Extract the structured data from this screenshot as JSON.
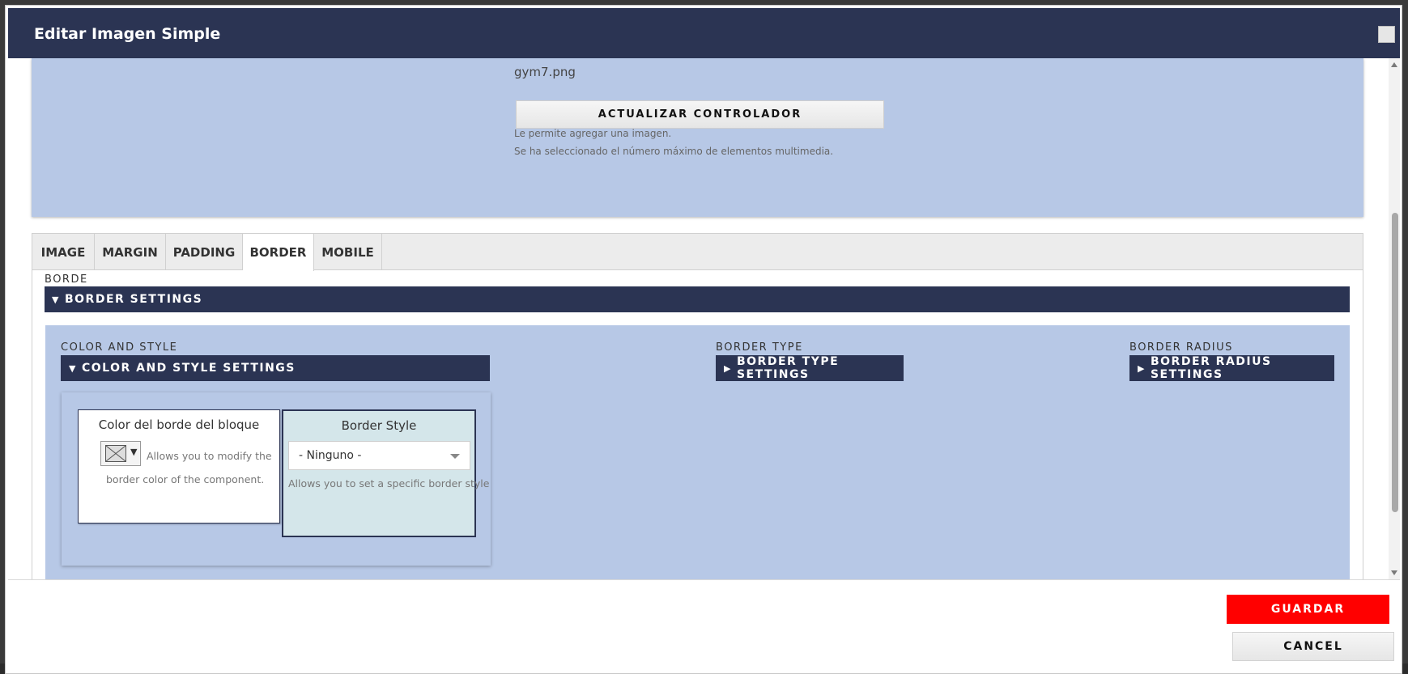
{
  "dialog": {
    "title": "Editar Imagen Simple"
  },
  "upload": {
    "filename": "gym7.png",
    "update_button": "ACTUALIZAR CONTROLADOR",
    "help_1": "Le permite agregar una imagen.",
    "help_2": "Se ha seleccionado el número máximo de elementos multimedia."
  },
  "tabs": [
    {
      "label": "IMAGE",
      "active": false
    },
    {
      "label": "MARGIN",
      "active": false
    },
    {
      "label": "PADDING",
      "active": false
    },
    {
      "label": "BORDER",
      "active": true
    },
    {
      "label": "MOBILE",
      "active": false
    }
  ],
  "border": {
    "section_label": "BORDE",
    "settings_bar": "BORDER SETTINGS",
    "color_style": {
      "label": "COLOR AND STYLE",
      "bar": "COLOR AND STYLE SETTINGS",
      "color_card": {
        "title": "Color del borde del bloque",
        "help": "Allows you to modify the border color of the component."
      },
      "style_card": {
        "title": "Border Style",
        "selected": "- Ninguno -",
        "help": "Allows you to set a specific border style"
      }
    },
    "border_type": {
      "label": "BORDER TYPE",
      "bar": "BORDER TYPE SETTINGS"
    },
    "border_radius": {
      "label": "BORDER RADIUS",
      "bar": "BORDER RADIUS SETTINGS"
    }
  },
  "footer": {
    "save": "GUARDAR",
    "cancel": "CANCEL"
  },
  "colors": {
    "navy": "#2b3453",
    "panel_blue": "#b7c8e6",
    "save_red": "#ff0000",
    "style_card_bg": "#d4e6ea"
  },
  "icons": {
    "expanded": "▼",
    "collapsed": "▶",
    "dropdown": "▾"
  }
}
